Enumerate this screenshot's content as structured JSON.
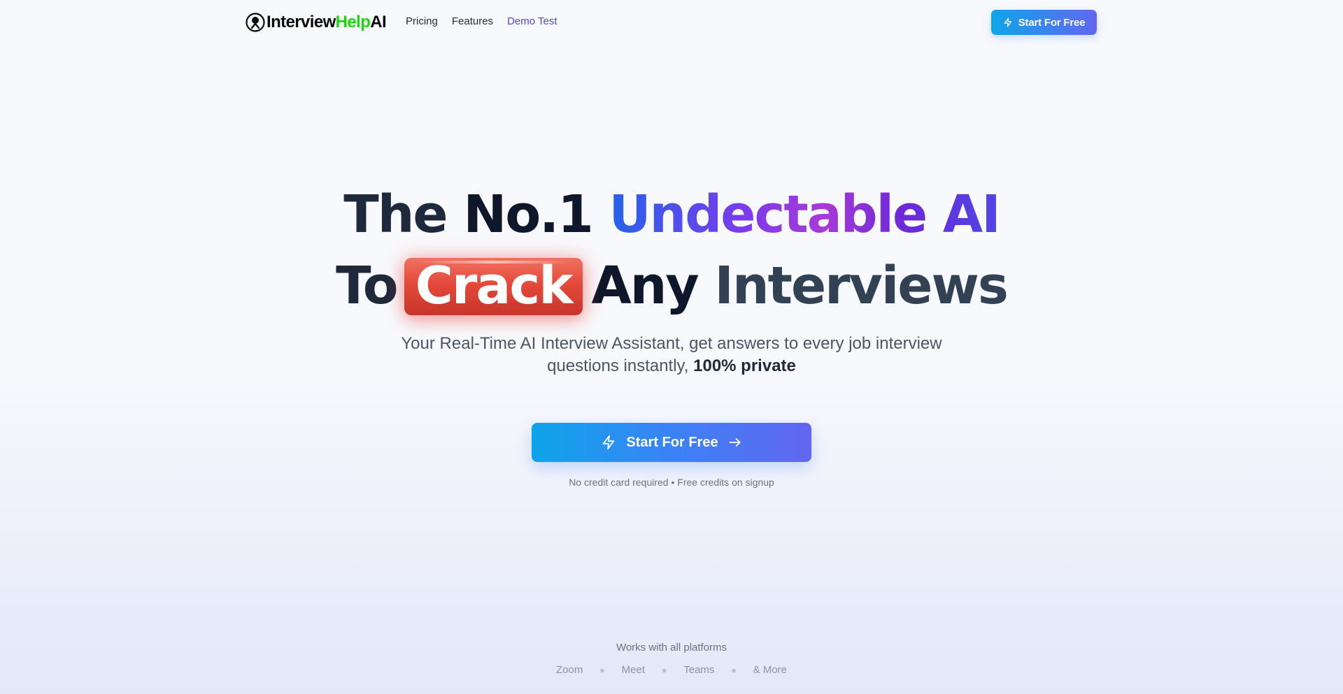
{
  "nav": {
    "logo": {
      "part1": "Interview",
      "part2": "Help",
      "part3": "AI"
    },
    "links": [
      "Pricing",
      "Features",
      "Demo Test"
    ],
    "cta_label": "Start For Free"
  },
  "hero": {
    "line1": {
      "a": "The",
      "b": "No.1",
      "c": "Undectable AI"
    },
    "line2": {
      "a": "To",
      "b": "Crack",
      "c": "Any",
      "d": "Interviews"
    },
    "subtitle": "Your Real-Time AI Interview Assistant, get answers to every job interview questions instantly,",
    "subtitle_bold": "100% private",
    "cta_label": "Start For Free",
    "note": "No credit card required • Free credits on signup"
  },
  "platforms": {
    "title": "Works with all platforms",
    "items": [
      "Zoom",
      "Meet",
      "Teams",
      "& More"
    ]
  },
  "colors": {
    "accent_start": "#0ea5e9",
    "accent_end": "#6366f1",
    "crack_red": "#e4493a",
    "logo_green": "#1ed60f"
  }
}
